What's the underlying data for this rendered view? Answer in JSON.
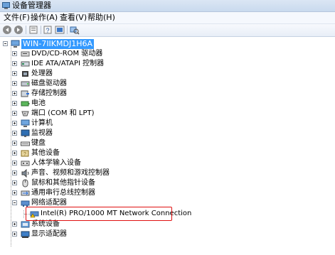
{
  "window": {
    "title": "设备管理器"
  },
  "menu": [
    {
      "label": "文件(F)"
    },
    {
      "label": "操作(A)"
    },
    {
      "label": "查看(V)"
    },
    {
      "label": "帮助(H)"
    }
  ],
  "toolbar": {
    "buttons": [
      "back-icon",
      "forward-icon",
      "properties-icon",
      "help-icon",
      "show-hidden-icon",
      "scan-hardware-icon"
    ]
  },
  "tree": {
    "root": "WIN-7IIKMDJ1H6A",
    "categories": [
      {
        "label": "DVD/CD-ROM 驱动器",
        "icon": "dvd-drive-icon",
        "expanded": false
      },
      {
        "label": "IDE ATA/ATAPI 控制器",
        "icon": "ide-controller-icon",
        "expanded": false
      },
      {
        "label": "处理器",
        "icon": "processor-icon",
        "expanded": false
      },
      {
        "label": "磁盘驱动器",
        "icon": "disk-drive-icon",
        "expanded": false
      },
      {
        "label": "存储控制器",
        "icon": "storage-controller-icon",
        "expanded": false
      },
      {
        "label": "电池",
        "icon": "battery-icon",
        "expanded": false
      },
      {
        "label": "端口 (COM 和 LPT)",
        "icon": "port-icon",
        "expanded": false
      },
      {
        "label": "计算机",
        "icon": "computer-icon",
        "expanded": false
      },
      {
        "label": "监视器",
        "icon": "monitor-icon",
        "expanded": false
      },
      {
        "label": "键盘",
        "icon": "keyboard-icon",
        "expanded": false
      },
      {
        "label": "其他设备",
        "icon": "other-devices-icon",
        "expanded": false
      },
      {
        "label": "人体学输入设备",
        "icon": "hid-icon",
        "expanded": false
      },
      {
        "label": "声音、视频和游戏控制器",
        "icon": "sound-icon",
        "expanded": false
      },
      {
        "label": "鼠标和其他指针设备",
        "icon": "mouse-icon",
        "expanded": false
      },
      {
        "label": "通用串行总线控制器",
        "icon": "usb-icon",
        "expanded": false
      },
      {
        "label": "网络适配器",
        "icon": "network-adapter-icon",
        "expanded": true
      },
      {
        "label": "系统设备",
        "icon": "system-devices-icon",
        "expanded": false
      },
      {
        "label": "显示适配器",
        "icon": "display-adapter-icon",
        "expanded": false
      }
    ],
    "network_child": "Intel(R) PRO/1000 MT Network Connection",
    "highlight_color": "#e01010",
    "selection_color": "#3399ff"
  }
}
